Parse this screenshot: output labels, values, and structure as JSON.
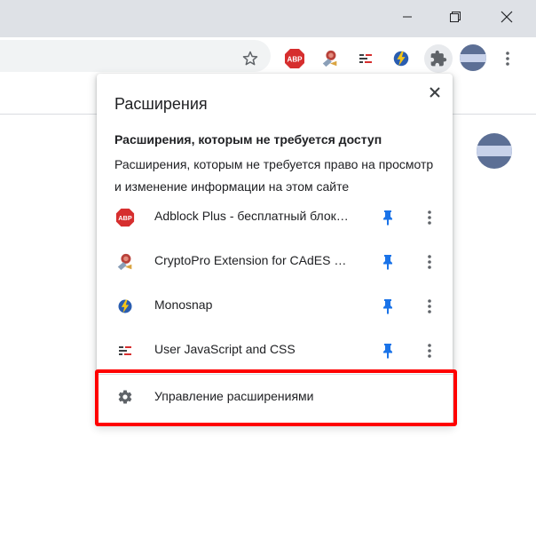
{
  "window": {
    "minimize_icon": "minimize-icon",
    "restore_icon": "restore-icon",
    "close_icon": "close-icon"
  },
  "toolbar": {
    "icons": [
      "star-icon",
      "adblock-plus-icon",
      "cryptopro-icon",
      "user-javascript-css-icon",
      "monosnap-icon",
      "puzzle-extensions-icon",
      "profile-avatar",
      "kebab-menu-icon"
    ]
  },
  "popup": {
    "title": "Расширения",
    "section_title": "Расширения, которым не требуется доступ",
    "section_description": "Расширения, которым не требуется право на просмотр и изменение информации на этом сайте",
    "extensions": [
      {
        "name": "Adblock Plus - бесплатный блокировщик рекламы",
        "icon": "abp-icon",
        "badge": "ABP"
      },
      {
        "name": "CryptoPro Extension for CAdES Browser Plug-in",
        "icon": "cryptopro-icon"
      },
      {
        "name": "Monosnap",
        "icon": "monosnap-icon"
      },
      {
        "name": "User JavaScript and CSS",
        "icon": "user-js-css-icon"
      }
    ],
    "manage_label": "Управление расширениями"
  },
  "colors": {
    "pin": "#1a73e8",
    "highlight": "#ff0000",
    "abp_red": "#d62e2e",
    "titlebar": "#dee1e6"
  }
}
